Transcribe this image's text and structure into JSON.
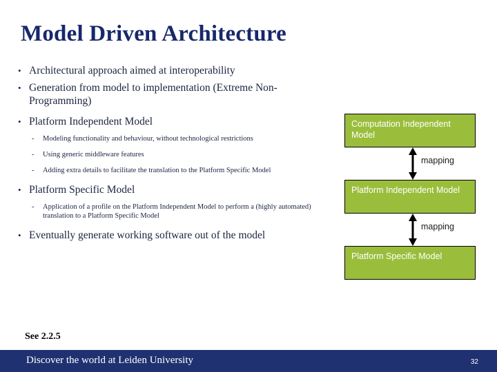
{
  "slide": {
    "title": "Model Driven Architecture",
    "reference_note": "See 2.2.5"
  },
  "content": {
    "bullets": [
      {
        "level": 1,
        "marker": "•",
        "text": "Architectural approach aimed at interoperability"
      },
      {
        "level": 1,
        "marker": "•",
        "text": "Generation from model to implementation (Extreme Non-Programming)"
      },
      {
        "level": 1,
        "marker": "•",
        "text": "Platform Independent Model"
      },
      {
        "level": 2,
        "marker": "-",
        "text": "Modeling functionality and behaviour, without technological restrictions"
      },
      {
        "level": 2,
        "marker": "-",
        "text": "Using generic middleware features"
      },
      {
        "level": 2,
        "marker": "-",
        "text": "Adding extra details to facilitate the translation to the Platform Specific Model"
      },
      {
        "level": 1,
        "marker": "•",
        "text": "Platform Specific Model"
      },
      {
        "level": 2,
        "marker": "-",
        "text": "Application of a profile on the Platform Independent Model to perform a (highly automated) translation to a Platform Specific Model"
      },
      {
        "level": 1,
        "marker": "•",
        "text": "Eventually generate working software out of the model"
      }
    ]
  },
  "diagram": {
    "boxes": [
      {
        "id": "cim",
        "label": "Computation Independent Model"
      },
      {
        "id": "pim",
        "label": "Platform Independent Model"
      },
      {
        "id": "psm",
        "label": "Platform Specific Model"
      }
    ],
    "connectors": [
      {
        "id": "cim-pim",
        "label": "mapping",
        "arrow": "double-headed-vertical"
      },
      {
        "id": "pim-psm",
        "label": "mapping",
        "arrow": "double-headed-vertical"
      }
    ],
    "colors": {
      "box_fill": "#9ABE3C",
      "box_border": "#000000",
      "box_text": "#ffffff",
      "arrow": "#000000",
      "label_text": "#1b1b1b"
    }
  },
  "footer": {
    "tagline": "Discover the world at Leiden University",
    "page_number": "32",
    "background": "#1F3170",
    "text_color": "#ffffff"
  },
  "theme": {
    "title_color": "#17286b",
    "body_text_color": "#1b2440",
    "page_background": "#ffffff"
  }
}
